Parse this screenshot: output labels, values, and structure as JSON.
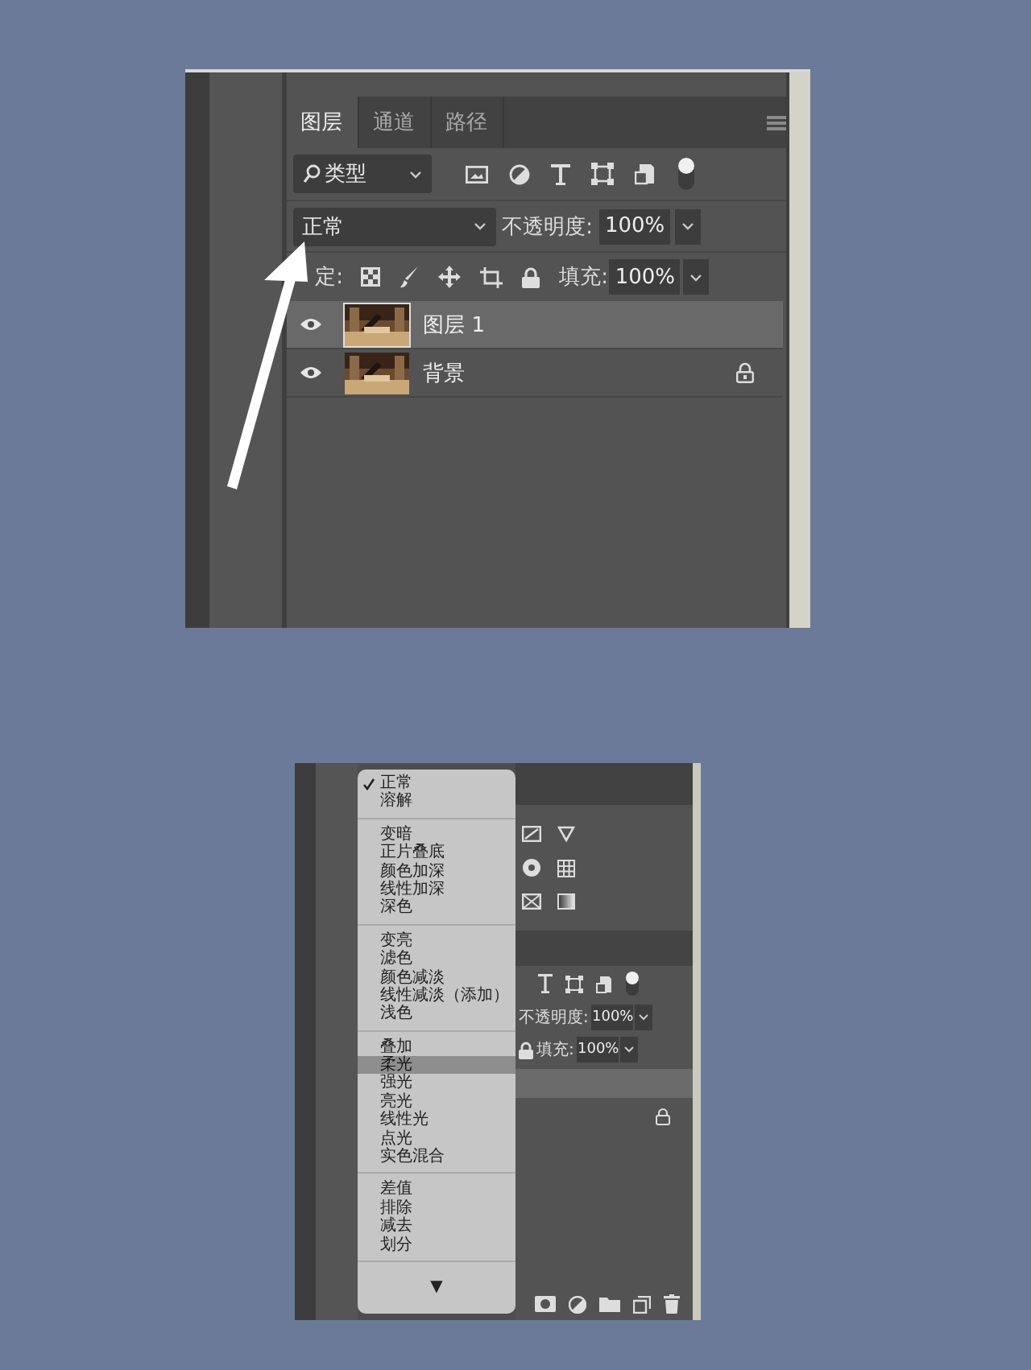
{
  "layers_panel": {
    "tabs": [
      {
        "label": "图层",
        "selected": true
      },
      {
        "label": "通道",
        "selected": false
      },
      {
        "label": "路径",
        "selected": false
      }
    ],
    "filter": {
      "label": "类型"
    },
    "blend_mode": "正常",
    "opacity_label": "不透明度:",
    "opacity": "100%",
    "lock_label": "定:",
    "fill_label": "填充:",
    "fill": "100%",
    "layers": [
      {
        "name": "图层 1",
        "selected": true,
        "visible": true,
        "locked": false
      },
      {
        "name": "背景",
        "selected": false,
        "visible": true,
        "locked": true
      }
    ]
  },
  "blend_menu_panel": {
    "opacity_label": "不透明度:",
    "opacity": "100%",
    "fill_label": "填充:",
    "fill": "100%",
    "layers": [
      {
        "selected": true,
        "locked": false
      },
      {
        "selected": false,
        "locked": true
      }
    ],
    "menu": {
      "groups": [
        {
          "items": [
            {
              "label": "正常",
              "checked": true,
              "selected": false
            },
            {
              "label": "溶解",
              "checked": false,
              "selected": false
            }
          ]
        },
        {
          "items": [
            {
              "label": "变暗",
              "checked": false,
              "selected": false
            },
            {
              "label": "正片叠底",
              "checked": false,
              "selected": false
            },
            {
              "label": "颜色加深",
              "checked": false,
              "selected": false
            },
            {
              "label": "线性加深",
              "checked": false,
              "selected": false
            },
            {
              "label": "深色",
              "checked": false,
              "selected": false
            }
          ]
        },
        {
          "items": [
            {
              "label": "变亮",
              "checked": false,
              "selected": false
            },
            {
              "label": "滤色",
              "checked": false,
              "selected": false
            },
            {
              "label": "颜色减淡",
              "checked": false,
              "selected": false
            },
            {
              "label": "线性减淡（添加）",
              "checked": false,
              "selected": false
            },
            {
              "label": "浅色",
              "checked": false,
              "selected": false
            }
          ]
        },
        {
          "items": [
            {
              "label": "叠加",
              "checked": false,
              "selected": false
            },
            {
              "label": "柔光",
              "checked": false,
              "selected": true
            },
            {
              "label": "强光",
              "checked": false,
              "selected": false
            },
            {
              "label": "亮光",
              "checked": false,
              "selected": false
            },
            {
              "label": "线性光",
              "checked": false,
              "selected": false
            },
            {
              "label": "点光",
              "checked": false,
              "selected": false
            },
            {
              "label": "实色混合",
              "checked": false,
              "selected": false
            }
          ]
        },
        {
          "items": [
            {
              "label": "差值",
              "checked": false,
              "selected": false
            },
            {
              "label": "排除",
              "checked": false,
              "selected": false
            },
            {
              "label": "减去",
              "checked": false,
              "selected": false
            },
            {
              "label": "划分",
              "checked": false,
              "selected": false
            }
          ]
        }
      ],
      "more": "▼"
    }
  }
}
